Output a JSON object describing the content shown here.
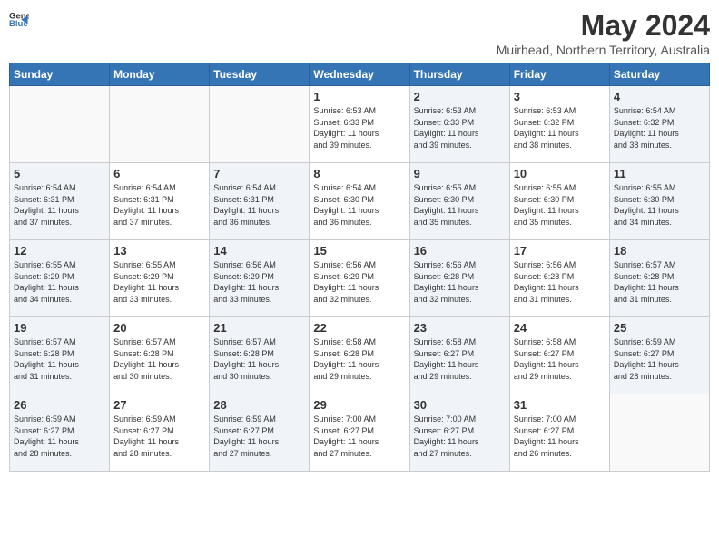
{
  "header": {
    "logo_general": "General",
    "logo_blue": "Blue",
    "title": "May 2024",
    "location": "Muirhead, Northern Territory, Australia"
  },
  "weekdays": [
    "Sunday",
    "Monday",
    "Tuesday",
    "Wednesday",
    "Thursday",
    "Friday",
    "Saturday"
  ],
  "weeks": [
    [
      {
        "day": "",
        "info": ""
      },
      {
        "day": "",
        "info": ""
      },
      {
        "day": "",
        "info": ""
      },
      {
        "day": "1",
        "info": "Sunrise: 6:53 AM\nSunset: 6:33 PM\nDaylight: 11 hours\nand 39 minutes."
      },
      {
        "day": "2",
        "info": "Sunrise: 6:53 AM\nSunset: 6:33 PM\nDaylight: 11 hours\nand 39 minutes."
      },
      {
        "day": "3",
        "info": "Sunrise: 6:53 AM\nSunset: 6:32 PM\nDaylight: 11 hours\nand 38 minutes."
      },
      {
        "day": "4",
        "info": "Sunrise: 6:54 AM\nSunset: 6:32 PM\nDaylight: 11 hours\nand 38 minutes."
      }
    ],
    [
      {
        "day": "5",
        "info": "Sunrise: 6:54 AM\nSunset: 6:31 PM\nDaylight: 11 hours\nand 37 minutes."
      },
      {
        "day": "6",
        "info": "Sunrise: 6:54 AM\nSunset: 6:31 PM\nDaylight: 11 hours\nand 37 minutes."
      },
      {
        "day": "7",
        "info": "Sunrise: 6:54 AM\nSunset: 6:31 PM\nDaylight: 11 hours\nand 36 minutes."
      },
      {
        "day": "8",
        "info": "Sunrise: 6:54 AM\nSunset: 6:30 PM\nDaylight: 11 hours\nand 36 minutes."
      },
      {
        "day": "9",
        "info": "Sunrise: 6:55 AM\nSunset: 6:30 PM\nDaylight: 11 hours\nand 35 minutes."
      },
      {
        "day": "10",
        "info": "Sunrise: 6:55 AM\nSunset: 6:30 PM\nDaylight: 11 hours\nand 35 minutes."
      },
      {
        "day": "11",
        "info": "Sunrise: 6:55 AM\nSunset: 6:30 PM\nDaylight: 11 hours\nand 34 minutes."
      }
    ],
    [
      {
        "day": "12",
        "info": "Sunrise: 6:55 AM\nSunset: 6:29 PM\nDaylight: 11 hours\nand 34 minutes."
      },
      {
        "day": "13",
        "info": "Sunrise: 6:55 AM\nSunset: 6:29 PM\nDaylight: 11 hours\nand 33 minutes."
      },
      {
        "day": "14",
        "info": "Sunrise: 6:56 AM\nSunset: 6:29 PM\nDaylight: 11 hours\nand 33 minutes."
      },
      {
        "day": "15",
        "info": "Sunrise: 6:56 AM\nSunset: 6:29 PM\nDaylight: 11 hours\nand 32 minutes."
      },
      {
        "day": "16",
        "info": "Sunrise: 6:56 AM\nSunset: 6:28 PM\nDaylight: 11 hours\nand 32 minutes."
      },
      {
        "day": "17",
        "info": "Sunrise: 6:56 AM\nSunset: 6:28 PM\nDaylight: 11 hours\nand 31 minutes."
      },
      {
        "day": "18",
        "info": "Sunrise: 6:57 AM\nSunset: 6:28 PM\nDaylight: 11 hours\nand 31 minutes."
      }
    ],
    [
      {
        "day": "19",
        "info": "Sunrise: 6:57 AM\nSunset: 6:28 PM\nDaylight: 11 hours\nand 31 minutes."
      },
      {
        "day": "20",
        "info": "Sunrise: 6:57 AM\nSunset: 6:28 PM\nDaylight: 11 hours\nand 30 minutes."
      },
      {
        "day": "21",
        "info": "Sunrise: 6:57 AM\nSunset: 6:28 PM\nDaylight: 11 hours\nand 30 minutes."
      },
      {
        "day": "22",
        "info": "Sunrise: 6:58 AM\nSunset: 6:28 PM\nDaylight: 11 hours\nand 29 minutes."
      },
      {
        "day": "23",
        "info": "Sunrise: 6:58 AM\nSunset: 6:27 PM\nDaylight: 11 hours\nand 29 minutes."
      },
      {
        "day": "24",
        "info": "Sunrise: 6:58 AM\nSunset: 6:27 PM\nDaylight: 11 hours\nand 29 minutes."
      },
      {
        "day": "25",
        "info": "Sunrise: 6:59 AM\nSunset: 6:27 PM\nDaylight: 11 hours\nand 28 minutes."
      }
    ],
    [
      {
        "day": "26",
        "info": "Sunrise: 6:59 AM\nSunset: 6:27 PM\nDaylight: 11 hours\nand 28 minutes."
      },
      {
        "day": "27",
        "info": "Sunrise: 6:59 AM\nSunset: 6:27 PM\nDaylight: 11 hours\nand 28 minutes."
      },
      {
        "day": "28",
        "info": "Sunrise: 6:59 AM\nSunset: 6:27 PM\nDaylight: 11 hours\nand 27 minutes."
      },
      {
        "day": "29",
        "info": "Sunrise: 7:00 AM\nSunset: 6:27 PM\nDaylight: 11 hours\nand 27 minutes."
      },
      {
        "day": "30",
        "info": "Sunrise: 7:00 AM\nSunset: 6:27 PM\nDaylight: 11 hours\nand 27 minutes."
      },
      {
        "day": "31",
        "info": "Sunrise: 7:00 AM\nSunset: 6:27 PM\nDaylight: 11 hours\nand 26 minutes."
      },
      {
        "day": "",
        "info": ""
      }
    ]
  ]
}
